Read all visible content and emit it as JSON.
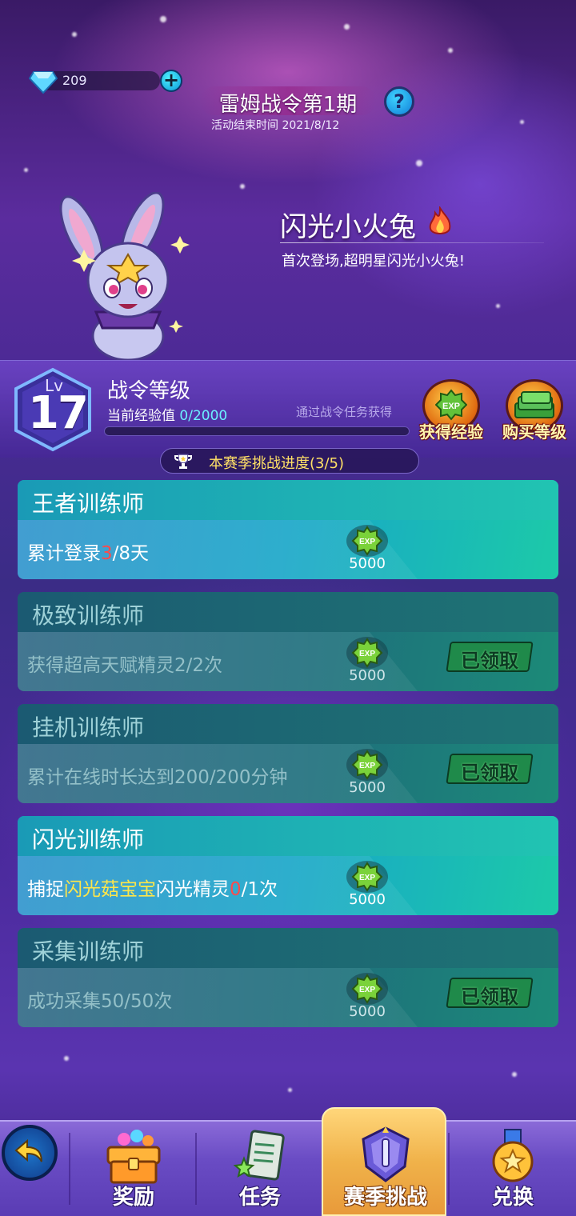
{
  "header": {
    "gem_count": "209",
    "title": "雷姆战令第1期",
    "end_time": "活动结束时间 2021/8/12"
  },
  "featured_pet": {
    "name": "闪光小火兔",
    "description": "首次登场,超明星闪光小火兔!"
  },
  "level": {
    "lv_label": "Lv",
    "level": "17",
    "title": "战令等级",
    "exp_label": "当前经验值 ",
    "exp_value": "0/2000",
    "exp_progress": 0,
    "hint": "通过战令任务获得",
    "actions": [
      {
        "label": "获得经验",
        "icon": "exp-coin-icon"
      },
      {
        "label": "购买等级",
        "icon": "cash-stack-icon"
      }
    ]
  },
  "challenge": {
    "title": "本赛季挑战进度",
    "progress": "(3/5)"
  },
  "tasks": [
    {
      "title": "王者训练师",
      "desc_parts": [
        {
          "t": "累计登录",
          "c": ""
        },
        {
          "t": "3",
          "c": "red"
        },
        {
          "t": "/8天",
          "c": ""
        }
      ],
      "reward": "5000",
      "status": "active",
      "claimed_label": ""
    },
    {
      "title": "极致训练师",
      "desc_parts": [
        {
          "t": "获得超高天赋精灵2/2次",
          "c": ""
        }
      ],
      "reward": "5000",
      "status": "claimed",
      "claimed_label": "已领取"
    },
    {
      "title": "挂机训练师",
      "desc_parts": [
        {
          "t": "累计在线时长达到200/200分钟",
          "c": ""
        }
      ],
      "reward": "5000",
      "status": "claimed",
      "claimed_label": "已领取"
    },
    {
      "title": "闪光训练师",
      "desc_parts": [
        {
          "t": "捕捉",
          "c": ""
        },
        {
          "t": "闪光菇宝宝",
          "c": "yellow"
        },
        {
          "t": "闪光精灵",
          "c": ""
        },
        {
          "t": "0",
          "c": "red"
        },
        {
          "t": "/1次",
          "c": ""
        }
      ],
      "reward": "5000",
      "status": "active",
      "claimed_label": ""
    },
    {
      "title": "采集训练师",
      "desc_parts": [
        {
          "t": "成功采集50/50次",
          "c": ""
        }
      ],
      "reward": "5000",
      "status": "claimed",
      "claimed_label": "已领取"
    }
  ],
  "nav": {
    "items": [
      {
        "label": "奖励",
        "icon": "treasure-chest-icon",
        "selected": false
      },
      {
        "label": "任务",
        "icon": "task-scroll-icon",
        "selected": false
      },
      {
        "label": "赛季挑战",
        "icon": "season-crest-icon",
        "selected": true
      },
      {
        "label": "兑换",
        "icon": "exchange-medal-icon",
        "selected": false
      }
    ]
  },
  "colors": {
    "accent_cyan": "#6cf0ff",
    "highlight_yellow": "#ffe64a",
    "highlight_red": "#ff4b4b",
    "claimed_green": "#1f8a4a"
  }
}
